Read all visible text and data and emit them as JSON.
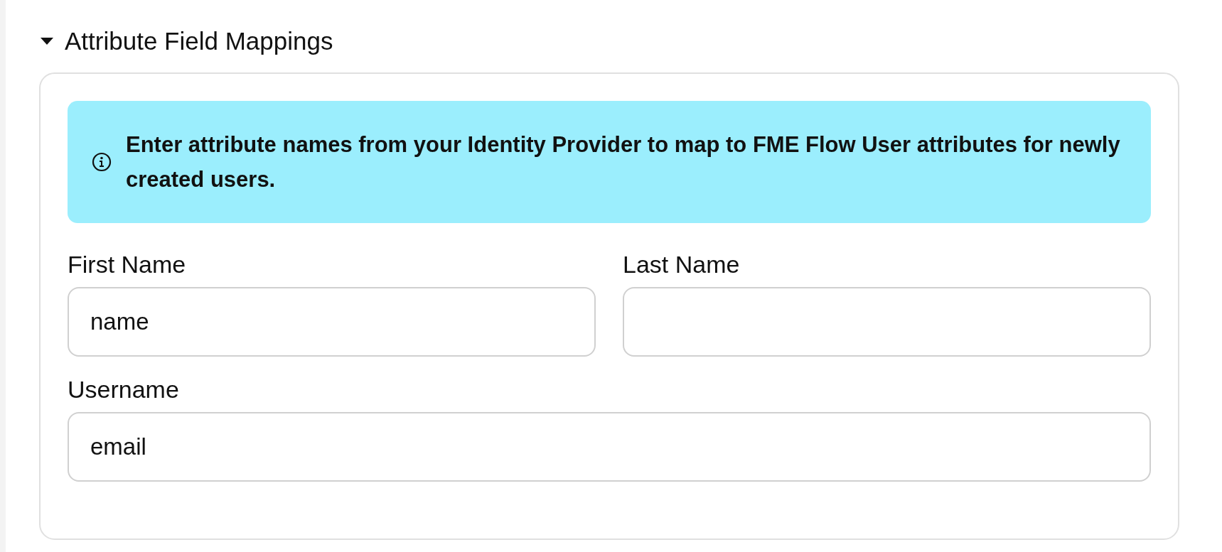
{
  "section": {
    "title": "Attribute Field Mappings",
    "expanded": true,
    "info": "Enter attribute names from your Identity Provider to map to FME Flow User attributes for newly created users.",
    "rows": [
      [
        {
          "label": "First Name",
          "value": "name"
        },
        {
          "label": "Last Name"
        }
      ],
      [
        {
          "label": "Username",
          "value": "email"
        }
      ]
    ]
  }
}
